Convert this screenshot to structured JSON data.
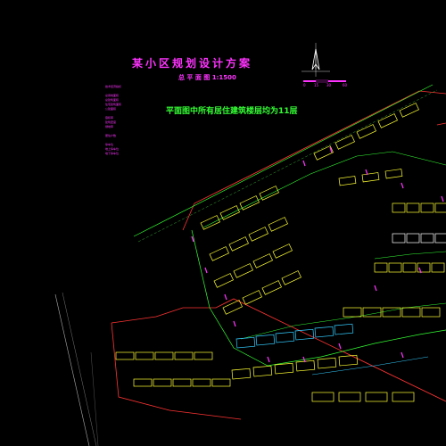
{
  "drawing": {
    "title": "某小区规划设计方案",
    "subtitle": "总 平 面 图  1:1500",
    "note": "平面图中所有居住建筑楼层均为11层",
    "legend_lines": [
      "技术经济指标",
      "",
      "总用地面积",
      "总建筑面积",
      "住宅建筑面积",
      "公建面积",
      "",
      "容积率",
      "建筑密度",
      "绿地率",
      "",
      "居住户数",
      "",
      "停车位",
      "地上停车位",
      "地下停车位"
    ],
    "scale_labels": [
      "0",
      "15",
      "30",
      "60"
    ]
  },
  "colors": {
    "background": "#000000",
    "title": "#ff33ff",
    "note": "#33ff33",
    "building": "#ffff33",
    "building_alt": "#33ccff",
    "road": "#33ff33",
    "boundary": "#ff3333",
    "marker": "#ff33ff"
  }
}
